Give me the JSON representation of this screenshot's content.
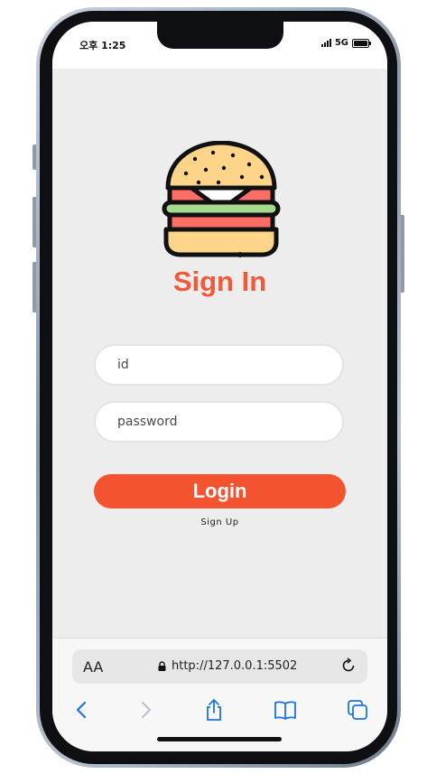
{
  "status_bar": {
    "time": "오후 1:25",
    "network": "5G",
    "icons": [
      "signal-icon",
      "battery-icon"
    ]
  },
  "app": {
    "logo": "burger-icon",
    "title": "Sign In",
    "id_placeholder": "id",
    "password_placeholder": "password",
    "login_label": "Login",
    "signup_label": "Sign Up",
    "accent_color": "#f4532f"
  },
  "browser": {
    "text_size_label": "AA",
    "url": "http://127.0.0.1:5502",
    "icons": [
      "lock-icon",
      "reload-icon",
      "back-icon",
      "forward-icon",
      "share-icon",
      "bookmarks-icon",
      "tabs-icon"
    ]
  }
}
